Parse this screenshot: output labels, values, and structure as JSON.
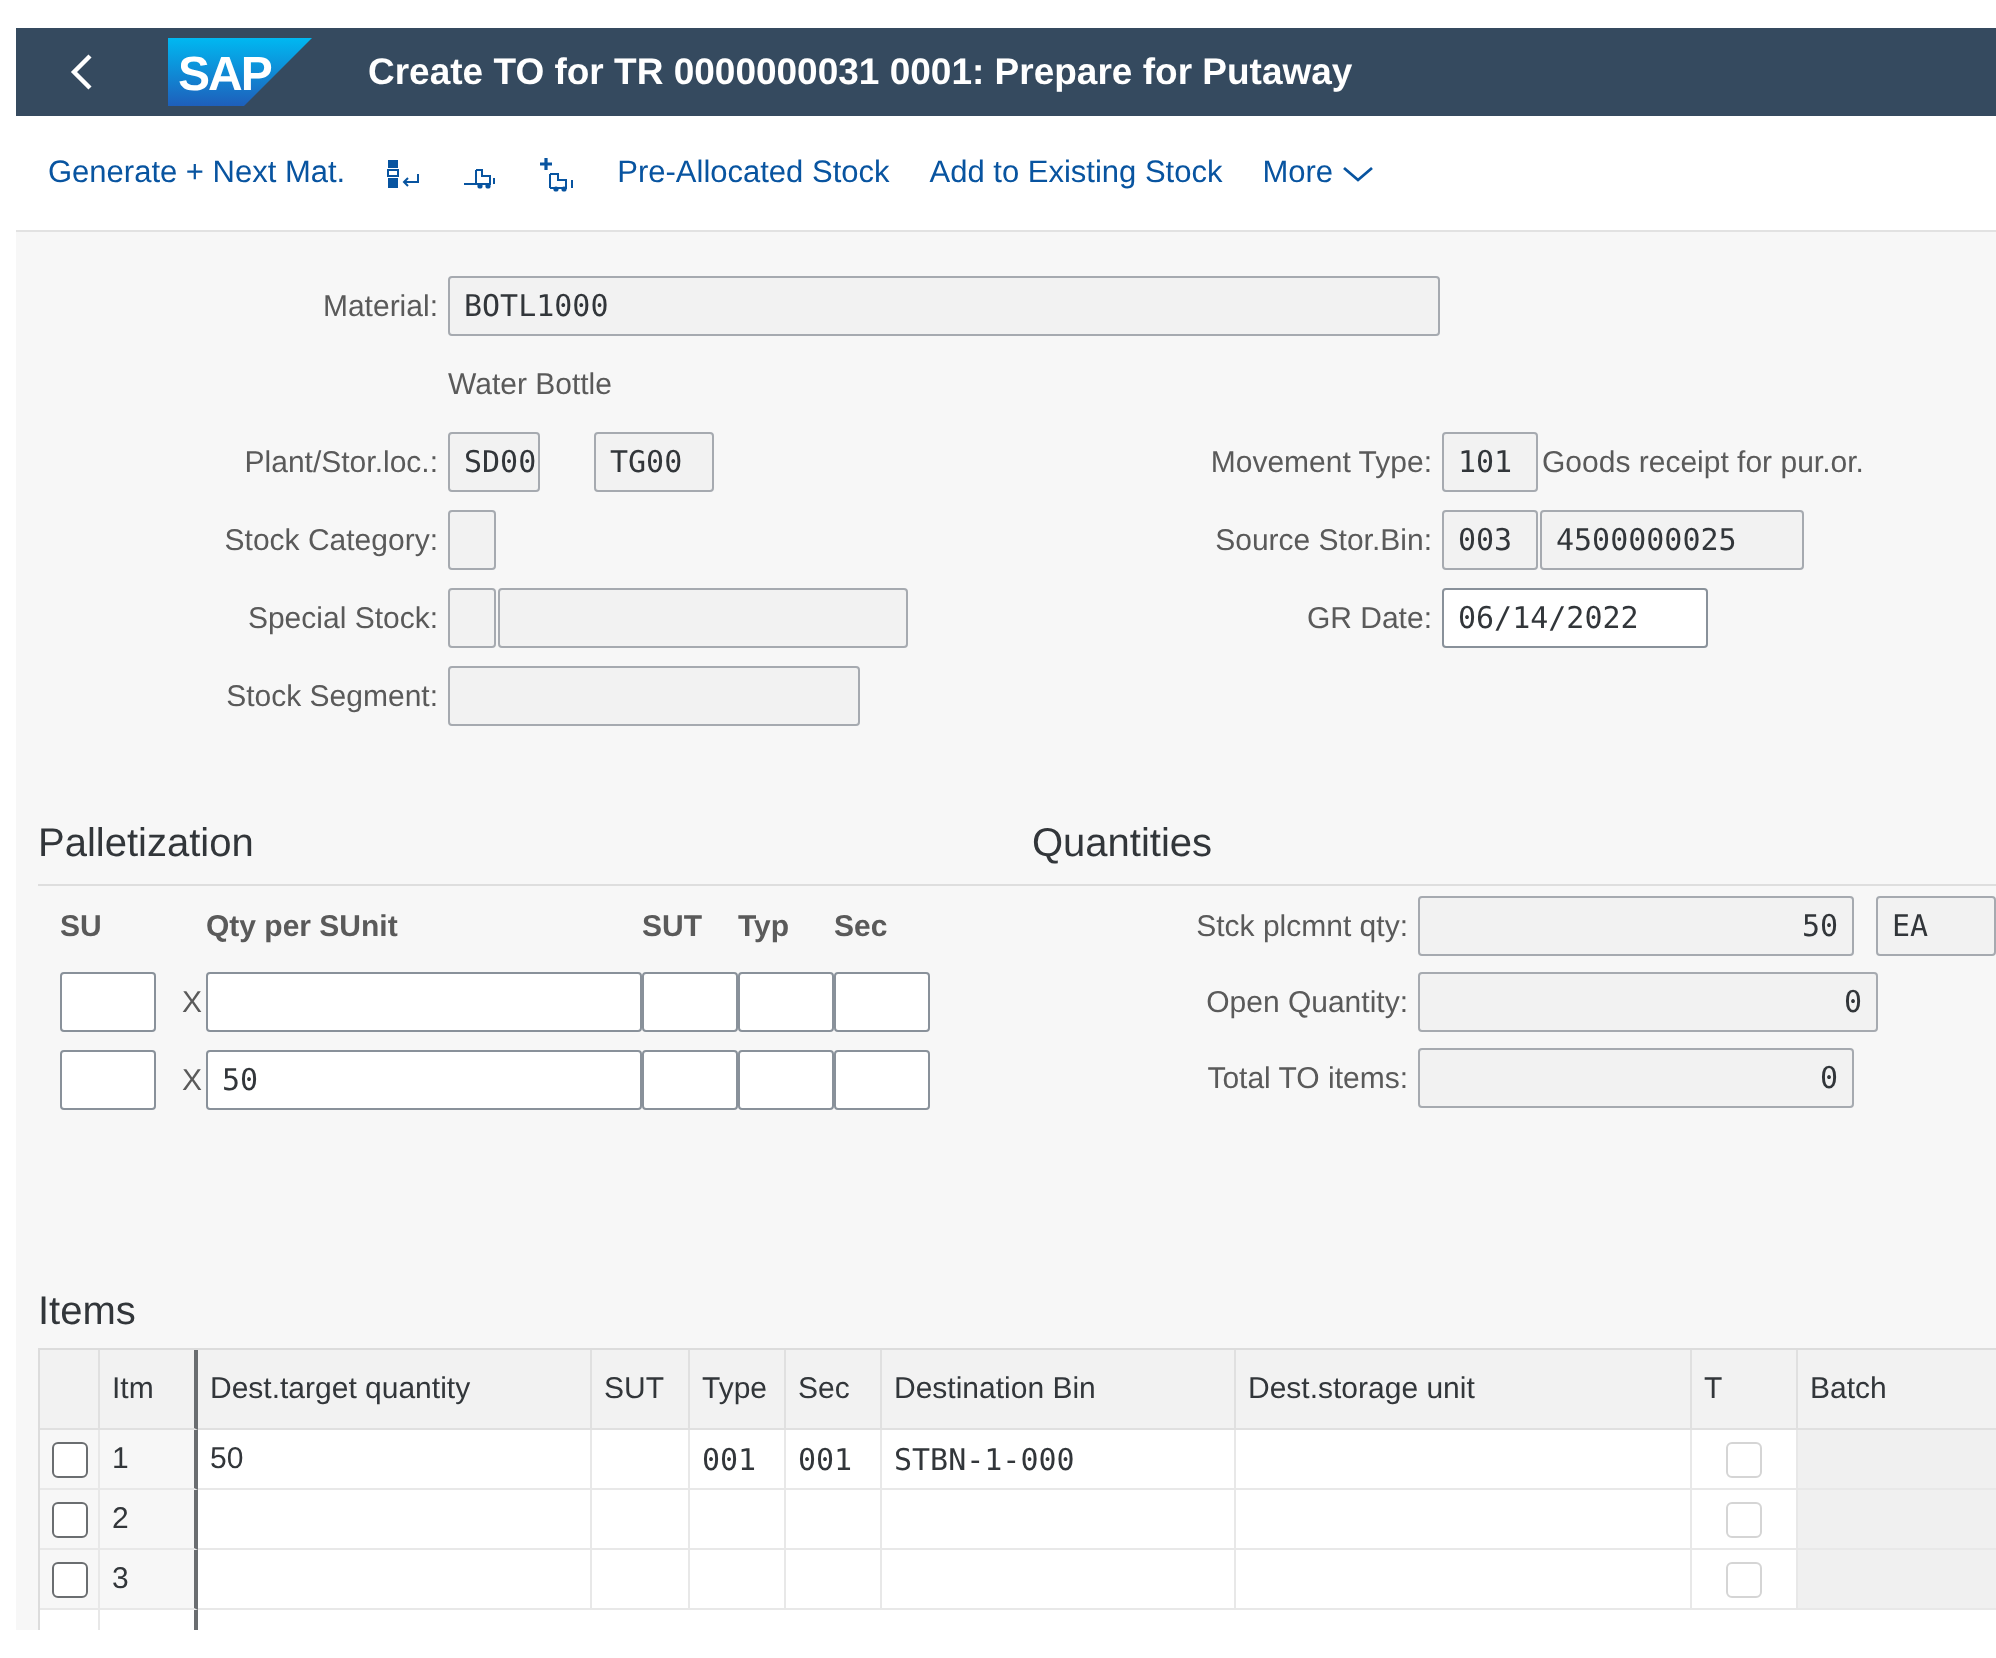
{
  "header": {
    "logo_text": "SAP",
    "title": "Create TO for TR 0000000031 0001: Prepare for Putaway"
  },
  "toolbar": [
    {
      "kind": "text",
      "label": "Generate + Next Mat."
    },
    {
      "kind": "icon"
    },
    {
      "kind": "icon"
    },
    {
      "kind": "icon"
    },
    {
      "kind": "text",
      "label": "Pre-Allocated Stock"
    },
    {
      "kind": "text",
      "label": "Add to Existing Stock"
    },
    {
      "kind": "menu",
      "label": "More"
    }
  ],
  "material": {
    "label": "Material:",
    "value": "BOTL1000",
    "editable": false,
    "description": "Water Bottle"
  },
  "left_fields": [
    {
      "label": "Plant/Stor.loc.:",
      "fields": [
        {
          "value": "SD00",
          "editable": false
        },
        {
          "value": "TG00",
          "editable": false
        }
      ]
    },
    {
      "label": "Stock Category:",
      "fields": [
        {
          "editable": false
        }
      ]
    },
    {
      "label": "Special Stock:",
      "fields": [
        {
          "editable": false
        },
        {
          "editable": false
        }
      ]
    },
    {
      "label": "Stock Segment:",
      "fields": [
        {
          "editable": false
        }
      ]
    }
  ],
  "right_fields": [
    {
      "label": "Movement Type:",
      "fields": [
        {
          "value": "101",
          "editable": false
        }
      ],
      "description": "Goods receipt for pur.or."
    },
    {
      "label": "Source Stor.Bin:",
      "fields": [
        {
          "value": "003",
          "editable": false
        },
        {
          "value": "4500000025",
          "editable": false
        }
      ]
    },
    {
      "label": "GR Date:",
      "fields": [
        {
          "value": "06/14/2022",
          "editable": true
        }
      ]
    }
  ],
  "palletization": {
    "title": "Palletization",
    "columns": [
      "SU",
      "Qty per SUnit",
      "SUT",
      "Typ",
      "Sec"
    ],
    "rows": [
      {
        "multiplier": "X"
      },
      {
        "multiplier": "X",
        "qty_per_sunit": "50"
      }
    ]
  },
  "quantities": {
    "title": "Quantities",
    "rows": [
      {
        "label": "Stck plcmnt qty:",
        "value": "50",
        "unit": "EA"
      },
      {
        "label": "Open Quantity:",
        "value": "0"
      },
      {
        "label": "Total TO items:",
        "value": "0"
      }
    ]
  },
  "items": {
    "title": "Items",
    "columns": [
      "Itm",
      "Dest.target quantity",
      "SUT",
      "Type",
      "Sec",
      "Destination Bin",
      "Dest.storage unit",
      "T",
      "Batch"
    ],
    "rows": [
      {
        "selected": false,
        "itm": "1",
        "dest_target_quantity": "50",
        "type": "001",
        "sec": "001",
        "destination_bin": "STBN-1-000",
        "t_checked": false
      },
      {
        "selected": false,
        "itm": "2",
        "t_checked": false
      },
      {
        "selected": false,
        "itm": "3",
        "t_checked": false
      }
    ]
  }
}
